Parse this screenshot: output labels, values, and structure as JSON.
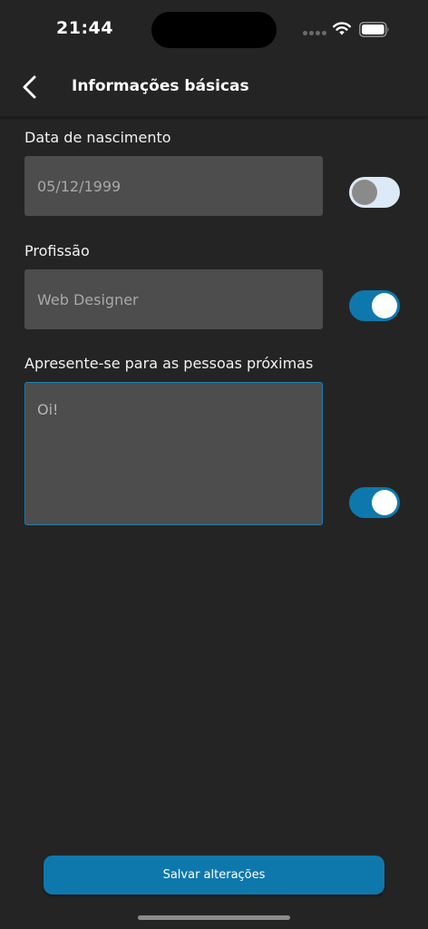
{
  "status_bar": {
    "time": "21:44",
    "icons": [
      "signal-dots-icon",
      "wifi-icon",
      "battery-icon"
    ]
  },
  "header": {
    "title": "Informações básicas",
    "back_icon": "chevron-left-icon"
  },
  "form": {
    "birth_date": {
      "label": "Data de nascimento",
      "value": "05/12/1999",
      "visible": false
    },
    "profession": {
      "label": "Profissão",
      "value": "Web Designer",
      "visible": true
    },
    "intro": {
      "label": "Apresente-se para as pessoas próximas",
      "value": "Oi!",
      "visible": true
    }
  },
  "save_button": {
    "label": "Salvar alterações"
  },
  "colors": {
    "background": "#242424",
    "input_bg": "#4d4d4d",
    "accent": "#0e78ad",
    "toggle_off_track": "#dce9f7"
  }
}
